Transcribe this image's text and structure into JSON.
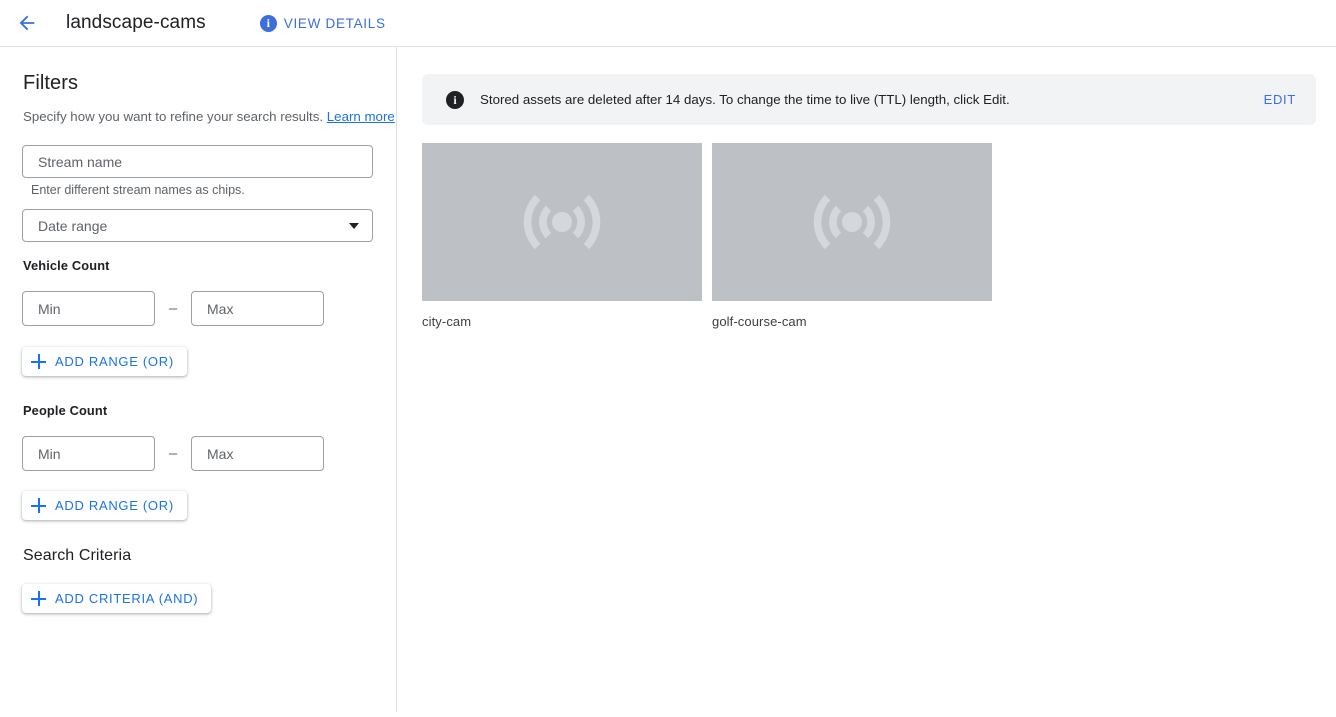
{
  "header": {
    "back_icon": "arrow-back-icon",
    "title": "landscape-cams",
    "view_details": {
      "icon": "info-icon",
      "label": "VIEW DETAILS"
    }
  },
  "sidebar": {
    "title": "Filters",
    "subtitle": "Specify how you want to refine your search results.",
    "learn_more": "Learn more",
    "stream_name": {
      "placeholder": "Stream name",
      "helper": "Enter different stream names as chips."
    },
    "date_range": {
      "placeholder": "Date range",
      "icon": "chevron-down-icon"
    },
    "vehicle_count": {
      "label": "Vehicle Count",
      "min_placeholder": "Min",
      "max_placeholder": "Max",
      "separator": "–",
      "add_range_label": "ADD RANGE (OR)"
    },
    "people_count": {
      "label": "People Count",
      "min_placeholder": "Min",
      "max_placeholder": "Max",
      "separator": "–",
      "add_range_label": "ADD RANGE (OR)"
    },
    "search_criteria": {
      "label": "Search Criteria",
      "add_criteria_label": "ADD CRITERIA (AND)"
    }
  },
  "main": {
    "banner": {
      "icon": "info-icon",
      "text": "Stored assets are deleted after 14 days. To change the time to live (TTL) length, click Edit.",
      "action_label": "EDIT"
    },
    "cards": [
      {
        "label": "city-cam",
        "icon": "sensors-stream-icon"
      },
      {
        "label": "golf-course-cam",
        "icon": "sensors-stream-icon"
      }
    ]
  },
  "colors": {
    "accent_blue": "#1a73e8",
    "link_blue": "#3c6ede",
    "banner_bg": "#f1f3f4",
    "thumb_bg": "#bdc1c6",
    "text_primary": "#202124",
    "text_secondary": "#5f6368"
  }
}
